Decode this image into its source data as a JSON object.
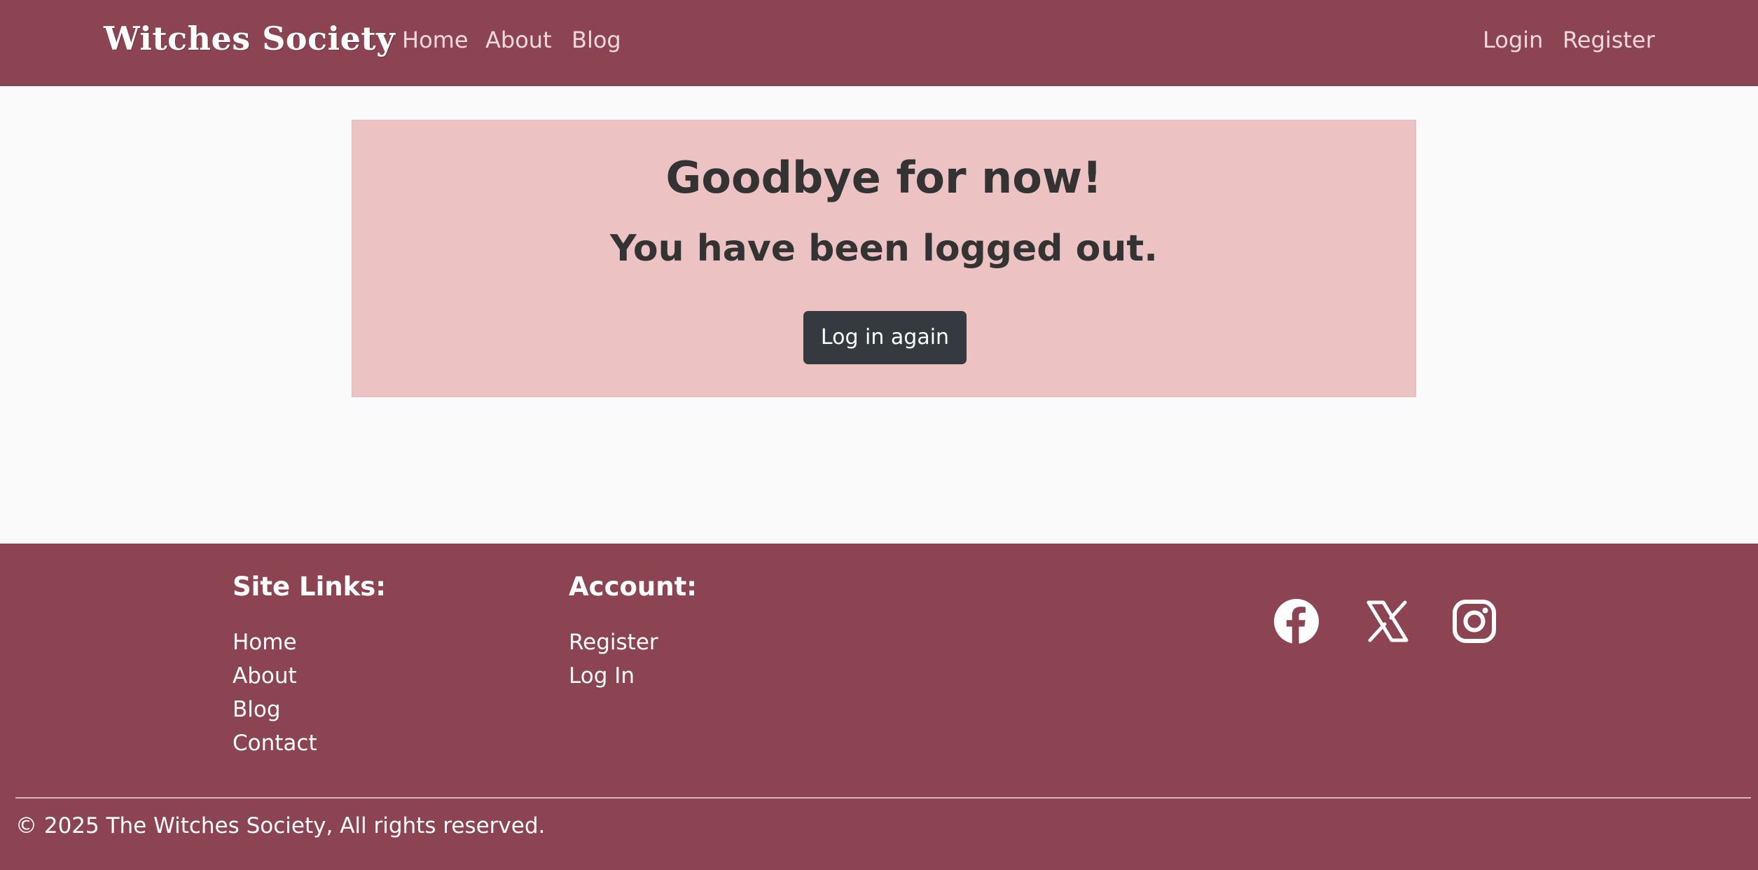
{
  "navbar": {
    "brand": "Witches Society",
    "links": [
      "Home",
      "About",
      "Blog"
    ],
    "auth_links": [
      "Login",
      "Register"
    ]
  },
  "alert": {
    "title": "Goodbye for now!",
    "subtitle": "You have been logged out.",
    "button_label": "Log in again"
  },
  "footer": {
    "site_links_heading": "Site Links:",
    "site_links": [
      "Home",
      "About",
      "Blog",
      "Contact"
    ],
    "account_heading": "Account:",
    "account_links": [
      "Register",
      "Log In"
    ],
    "social_icons": [
      "facebook-icon",
      "x-icon",
      "instagram-icon"
    ],
    "copyright": "© 2025 The Witches Society, All rights reserved."
  },
  "colors": {
    "primary": "#8d4452",
    "alert_bg": "#edc2c3",
    "button_dark": "#343a40",
    "page_bg": "#fafafa"
  }
}
